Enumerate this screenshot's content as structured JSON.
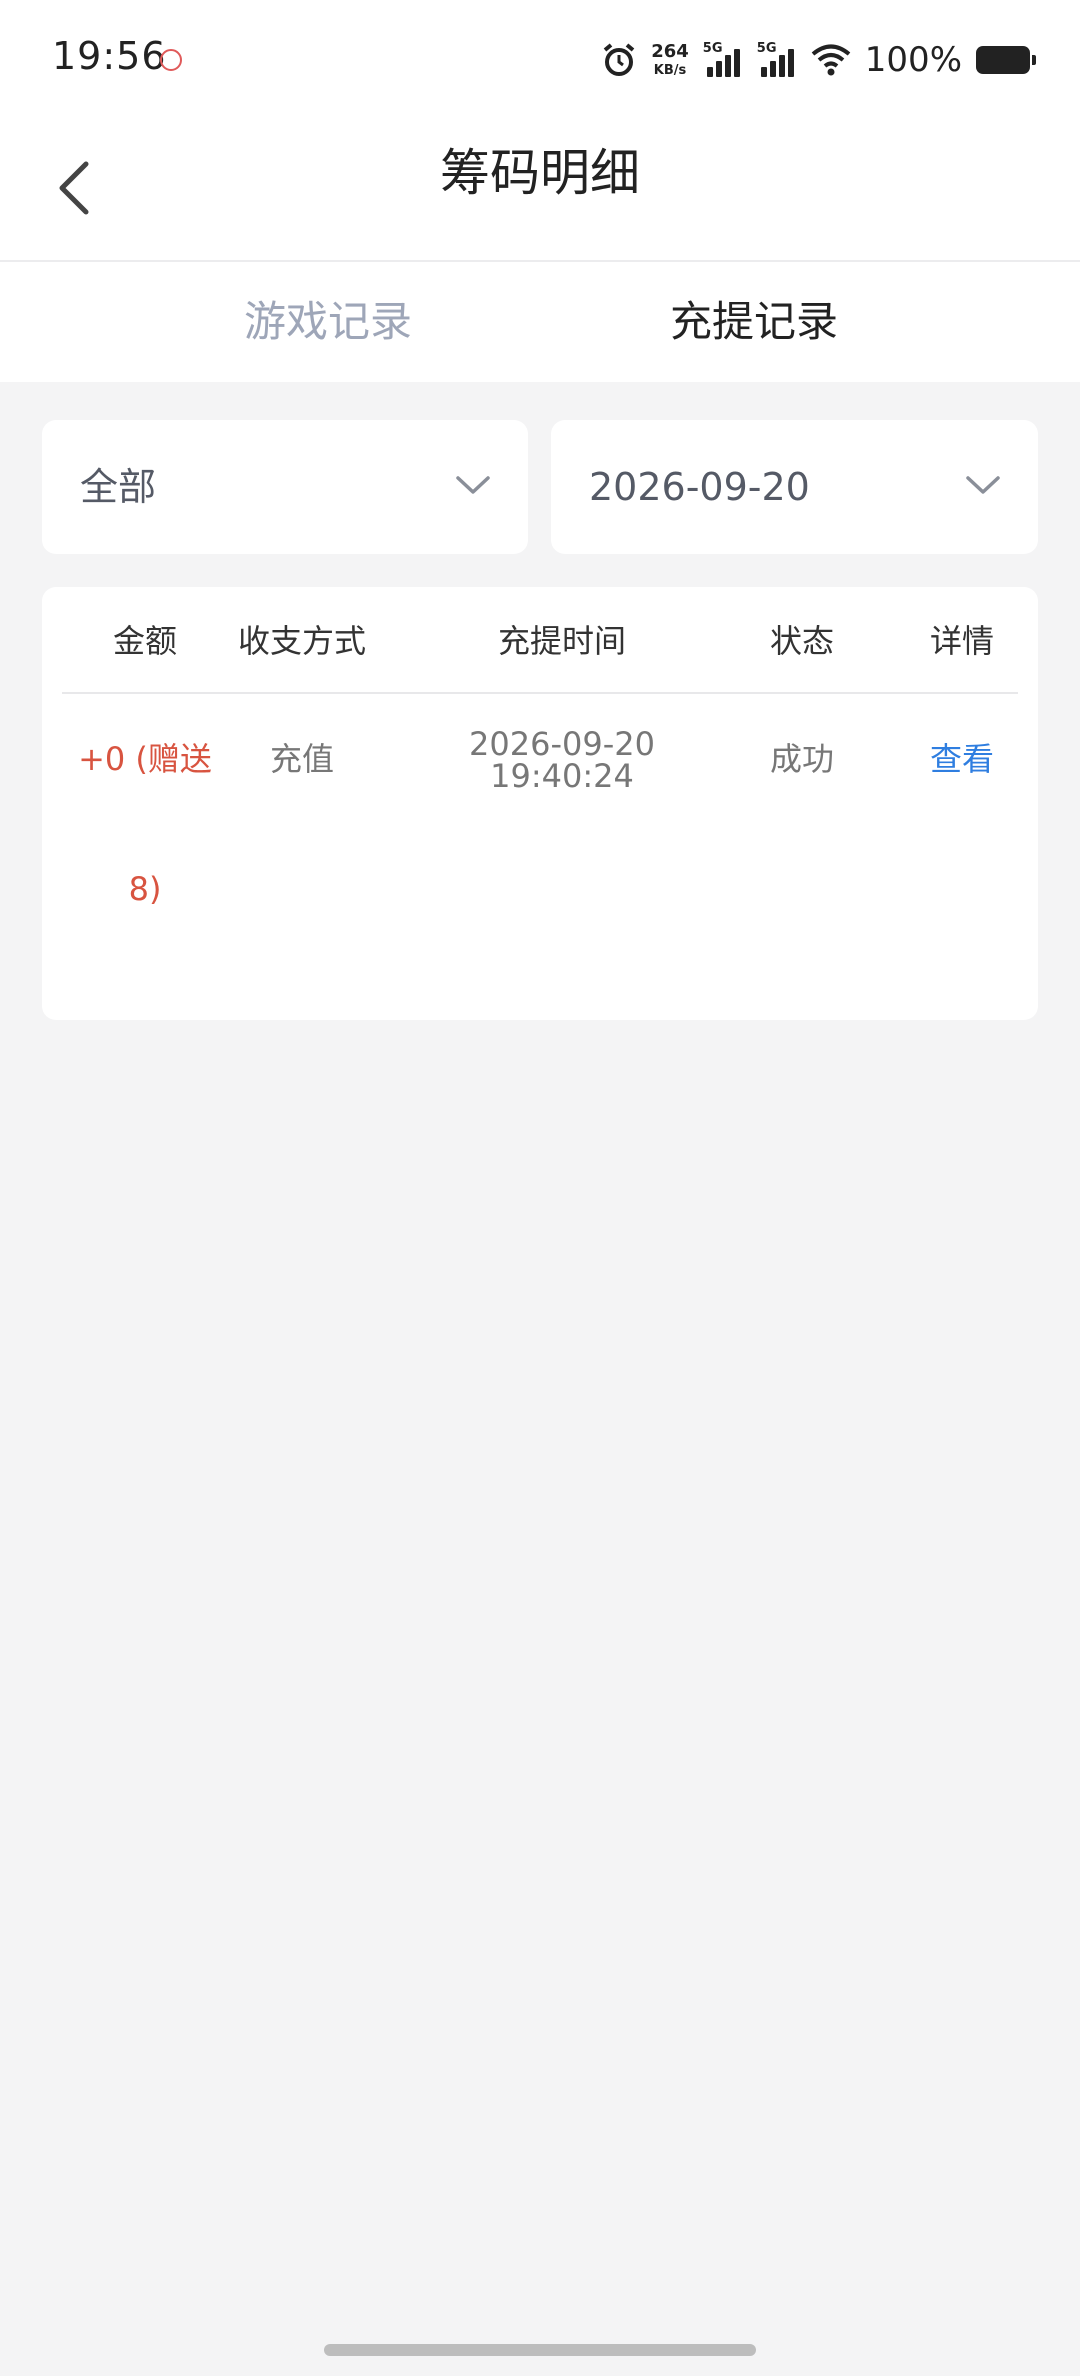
{
  "status_bar": {
    "time": "19:56",
    "net_speed_value": "264",
    "net_speed_unit": "KB/s",
    "sim1_tag": "5G",
    "sim2_tag": "5G",
    "battery_pct": "100%",
    "icons": [
      "alarm-icon",
      "signal-icon",
      "wifi-icon",
      "battery-icon"
    ]
  },
  "nav": {
    "title": "筹码明细",
    "back_icon": "chevron-left-icon"
  },
  "tabs": [
    {
      "label": "游戏记录",
      "active": false
    },
    {
      "label": "充提记录",
      "active": true
    }
  ],
  "filters": {
    "type": {
      "value": "全部"
    },
    "date": {
      "value": "2026-09-20"
    }
  },
  "table": {
    "headers": [
      "金额",
      "收支方式",
      "充提时间",
      "状态",
      "详情"
    ],
    "rows": [
      {
        "amount": "+0 (赠送8)",
        "method": "充值",
        "date": "2026-09-20",
        "time": "19:40:24",
        "status": "成功",
        "detail": "查看"
      }
    ]
  },
  "colors": {
    "amount": "#d85440",
    "link": "#2f7ee0",
    "inactive_tab": "#9ea6b8",
    "background": "#f4f4f5"
  }
}
